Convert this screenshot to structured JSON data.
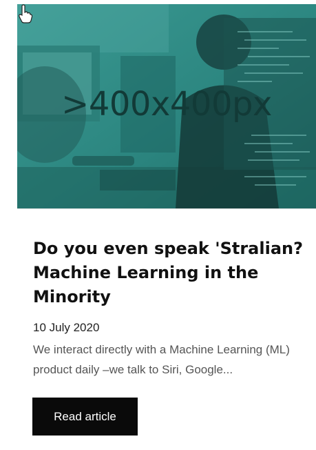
{
  "card": {
    "image_placeholder": ">400x400px",
    "title": "Do you even speak 'Stralian? Machine Learning in the Minority",
    "date": "10 July 2020",
    "excerpt": "We interact directly with a Machine Learning (ML) product daily –we talk to Siri, Google...",
    "cta_label": "Read article"
  },
  "colors": {
    "hero_tint": "#2f8f89",
    "button_bg": "#0a0a0a",
    "button_text": "#ffffff"
  },
  "icons": {
    "cursor": "hand-pointer-icon"
  }
}
